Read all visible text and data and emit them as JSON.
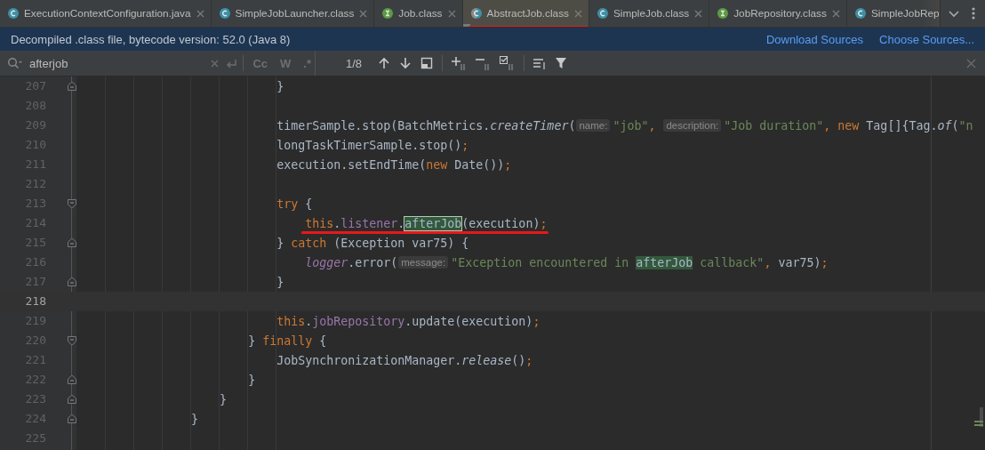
{
  "tabs": [
    {
      "label": "ExecutionContextConfiguration.java",
      "kind": "class",
      "selected": false,
      "annotated": false,
      "cut": false
    },
    {
      "label": "SimpleJobLauncher.class",
      "kind": "class",
      "selected": false,
      "annotated": false,
      "cut": false
    },
    {
      "label": "Job.class",
      "kind": "interface",
      "selected": false,
      "annotated": false,
      "cut": false
    },
    {
      "label": "AbstractJob.class",
      "kind": "abstract",
      "selected": true,
      "annotated": true,
      "cut": false
    },
    {
      "label": "SimpleJob.class",
      "kind": "class",
      "selected": false,
      "annotated": false,
      "cut": false
    },
    {
      "label": "JobRepository.class",
      "kind": "interface",
      "selected": false,
      "annotated": false,
      "cut": false
    },
    {
      "label": "SimpleJobRep",
      "kind": "class",
      "selected": false,
      "annotated": false,
      "cut": true
    }
  ],
  "banner": {
    "message": "Decompiled .class file, bytecode version: 52.0 (Java 8)",
    "links": [
      "Download Sources",
      "Choose Sources..."
    ]
  },
  "search": {
    "value": "afterjob",
    "toggles": [
      "Cc",
      "W",
      ".*"
    ],
    "count": "1/8"
  },
  "editor": {
    "lines": [
      {
        "number": "207",
        "kind": "fold-end",
        "current": false,
        "annotated": false,
        "tokens": [
          {
            "kind": "plain",
            "text": "                            }"
          }
        ]
      },
      {
        "number": "208",
        "kind": "plain",
        "current": false,
        "annotated": false
      },
      {
        "number": "209",
        "kind": "plain",
        "current": false,
        "annotated": false,
        "tokens": [
          {
            "kind": "plain",
            "text": "                            timerSample.stop(BatchMetrics."
          },
          {
            "kind": "static",
            "text": "createTimer"
          },
          {
            "kind": "plain",
            "text": "("
          },
          {
            "kind": "hint",
            "text": "name:"
          },
          {
            "kind": "string",
            "text": "\"job\""
          },
          {
            "kind": "keyword",
            "text": ", "
          },
          {
            "kind": "hint",
            "text": "description:"
          },
          {
            "kind": "string",
            "text": "\"Job duration\""
          },
          {
            "kind": "keyword",
            "text": ", new "
          },
          {
            "kind": "plain",
            "text": "Tag[]{Tag."
          },
          {
            "kind": "static",
            "text": "of"
          },
          {
            "kind": "plain",
            "text": "("
          },
          {
            "kind": "string",
            "text": "\"n"
          }
        ]
      },
      {
        "number": "210",
        "kind": "plain",
        "current": false,
        "annotated": false,
        "tokens": [
          {
            "kind": "plain",
            "text": "                            longTaskTimerSample.stop()"
          },
          {
            "kind": "keyword",
            "text": ";"
          }
        ]
      },
      {
        "number": "211",
        "kind": "plain",
        "current": false,
        "annotated": false,
        "tokens": [
          {
            "kind": "plain",
            "text": "                            execution.setEndTime("
          },
          {
            "kind": "keyword",
            "text": "new "
          },
          {
            "kind": "plain",
            "text": "Date())"
          },
          {
            "kind": "keyword",
            "text": ";"
          }
        ]
      },
      {
        "number": "212",
        "kind": "plain",
        "current": false,
        "annotated": false
      },
      {
        "number": "213",
        "kind": "fold-start",
        "current": false,
        "annotated": false,
        "tokens": [
          {
            "kind": "keyword",
            "text": "                            try "
          },
          {
            "kind": "plain",
            "text": "{"
          }
        ]
      },
      {
        "number": "214",
        "kind": "plain",
        "current": false,
        "annotated": true,
        "tokens": [
          {
            "kind": "keyword",
            "text": "                                this"
          },
          {
            "kind": "plain",
            "text": "."
          },
          {
            "kind": "field",
            "text": "listener"
          },
          {
            "kind": "plain",
            "text": "."
          },
          {
            "kind": "current-match",
            "text": "afterJob"
          },
          {
            "kind": "plain",
            "text": "(execution)"
          },
          {
            "kind": "keyword",
            "text": ";"
          }
        ]
      },
      {
        "number": "215",
        "kind": "fold-end",
        "current": false,
        "annotated": false,
        "tokens": [
          {
            "kind": "plain",
            "text": "                            } "
          },
          {
            "kind": "keyword",
            "text": "catch "
          },
          {
            "kind": "plain",
            "text": "(Exception var75) {"
          }
        ]
      },
      {
        "number": "216",
        "kind": "plain",
        "current": false,
        "annotated": false,
        "tokens": [
          {
            "kind": "static-field",
            "text": "                                logger"
          },
          {
            "kind": "plain",
            "text": ".error("
          },
          {
            "kind": "hint",
            "text": "message:"
          },
          {
            "kind": "string",
            "text": "\"Exception encountered in "
          },
          {
            "kind": "match",
            "text": "afterJob"
          },
          {
            "kind": "string",
            "text": " callback\""
          },
          {
            "kind": "keyword",
            "text": ", "
          },
          {
            "kind": "plain",
            "text": "var75)"
          },
          {
            "kind": "keyword",
            "text": ";"
          }
        ]
      },
      {
        "number": "217",
        "kind": "fold-end",
        "current": false,
        "annotated": false,
        "tokens": [
          {
            "kind": "plain",
            "text": "                            }"
          }
        ]
      },
      {
        "number": "218",
        "kind": "plain",
        "current": true,
        "annotated": false
      },
      {
        "number": "219",
        "kind": "plain",
        "current": false,
        "annotated": false,
        "tokens": [
          {
            "kind": "keyword",
            "text": "                            this"
          },
          {
            "kind": "plain",
            "text": "."
          },
          {
            "kind": "field",
            "text": "jobRepository"
          },
          {
            "kind": "plain",
            "text": ".update(execution)"
          },
          {
            "kind": "keyword",
            "text": ";"
          }
        ]
      },
      {
        "number": "220",
        "kind": "fold-start",
        "current": false,
        "annotated": false,
        "tokens": [
          {
            "kind": "plain",
            "text": "                        } "
          },
          {
            "kind": "keyword",
            "text": "finally "
          },
          {
            "kind": "plain",
            "text": "{"
          }
        ]
      },
      {
        "number": "221",
        "kind": "plain",
        "current": false,
        "annotated": false,
        "tokens": [
          {
            "kind": "plain",
            "text": "                            JobSynchronizationManager."
          },
          {
            "kind": "static",
            "text": "release"
          },
          {
            "kind": "plain",
            "text": "()"
          },
          {
            "kind": "keyword",
            "text": ";"
          }
        ]
      },
      {
        "number": "222",
        "kind": "fold-end",
        "current": false,
        "annotated": false,
        "tokens": [
          {
            "kind": "plain",
            "text": "                        }"
          }
        ]
      },
      {
        "number": "223",
        "kind": "fold-end",
        "current": false,
        "annotated": false,
        "tokens": [
          {
            "kind": "plain",
            "text": "                    }"
          }
        ]
      },
      {
        "number": "224",
        "kind": "fold-end",
        "current": false,
        "annotated": false,
        "tokens": [
          {
            "kind": "plain",
            "text": "                }"
          }
        ]
      },
      {
        "number": "225",
        "kind": "plain",
        "current": false,
        "annotated": false
      }
    ]
  }
}
